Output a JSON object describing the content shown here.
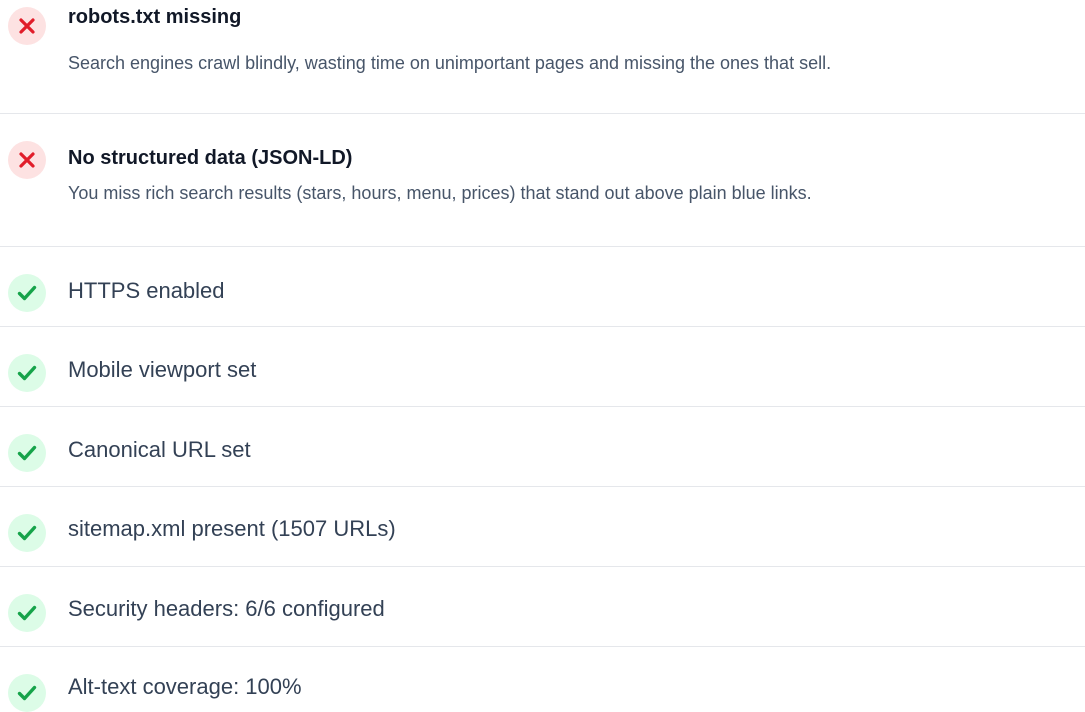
{
  "colors": {
    "fail_icon": "#e11d2a",
    "fail_bg": "#fde2e2",
    "pass_icon": "#16a34a",
    "pass_bg": "#dcfce7",
    "divider": "#e5e7eb"
  },
  "failures": [
    {
      "icon": "x-icon",
      "title": "robots.txt missing",
      "description": "Search engines crawl blindly, wasting time on unimportant pages and missing the ones that sell."
    },
    {
      "icon": "x-icon",
      "title": "No structured data (JSON-LD)",
      "description": "You miss rich search results (stars, hours, menu, prices) that stand out above plain blue links."
    }
  ],
  "passes": [
    {
      "icon": "check-icon",
      "label": "HTTPS enabled"
    },
    {
      "icon": "check-icon",
      "label": "Mobile viewport set"
    },
    {
      "icon": "check-icon",
      "label": "Canonical URL set"
    },
    {
      "icon": "check-icon",
      "label": "sitemap.xml present (1507 URLs)"
    },
    {
      "icon": "check-icon",
      "label": "Security headers: 6/6 configured"
    },
    {
      "icon": "check-icon",
      "label": "Alt-text coverage: 100%"
    }
  ]
}
